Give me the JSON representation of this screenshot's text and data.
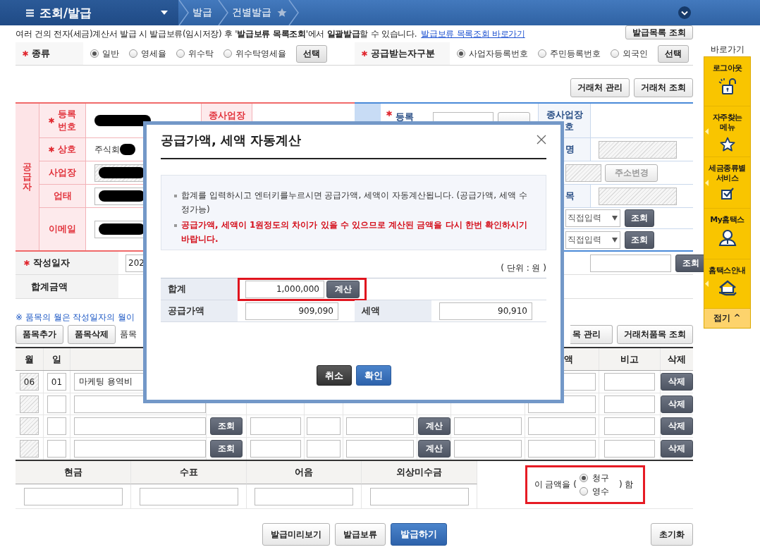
{
  "nav": {
    "title": "조회/발급",
    "breadcrumb": [
      {
        "label": "발급"
      },
      {
        "label": "건별발급",
        "favorite": false
      }
    ]
  },
  "notice": {
    "text": "여러 건의 전자(세금)계산서 발급 시 발급보류(임시저장) 후 '**발급보류 목록조회**'에서 **일괄발급**할 수 있습니다.",
    "link": "발급보류 목록조회 바로가기",
    "button": "발급목록 조회"
  },
  "type_row": {
    "groups": [
      {
        "label": "종류",
        "required": true,
        "options": [
          {
            "label": "일반",
            "selected": true
          },
          {
            "label": "영세율",
            "selected": false
          },
          {
            "label": "위수탁",
            "selected": false
          },
          {
            "label": "위수탁영세율",
            "selected": false
          }
        ],
        "button": "선택"
      },
      {
        "label": "공급받는자구분",
        "required": true,
        "options": [
          {
            "label": "사업자등록번호",
            "selected": true
          },
          {
            "label": "주민등록번호",
            "selected": false
          },
          {
            "label": "외국인",
            "selected": false
          }
        ],
        "button": "선택"
      }
    ]
  },
  "party_buttons": [
    "거래처 관리",
    "거래처 조회"
  ],
  "supplier": {
    "side_label": "공급자",
    "rows": [
      {
        "kind": "text",
        "label": "등록\n번호",
        "required": true,
        "redacted": true,
        "extra_label": "종사업장"
      },
      {
        "kind": "text",
        "label": "상호",
        "required": true,
        "value": "주식회",
        "redacted": true
      },
      {
        "kind": "input",
        "label": "사업장",
        "required": false,
        "redacted": true,
        "disabled": true
      },
      {
        "kind": "input",
        "label": "업태",
        "required": false,
        "redacted": true,
        "disabled": false
      },
      {
        "kind": "input",
        "label": "이메일",
        "required": false,
        "redacted": true,
        "disabled": false
      }
    ]
  },
  "buyer": {
    "id_label": "등록",
    "id_required": true,
    "branch_label": [
      "종사업장",
      "호"
    ],
    "rows": [
      {
        "kind": "labeled_field",
        "label": "명",
        "disabled": true
      },
      {
        "kind": "field_button",
        "disabled": true,
        "button": "주소변경"
      },
      {
        "kind": "labeled_field",
        "label": "목",
        "disabled": true
      },
      {
        "kind": "select_button",
        "value": "직접입력",
        "button": "조회",
        "disabled": false
      },
      {
        "kind": "select_button",
        "value": "직접입력",
        "button": "조회",
        "disabled": false
      }
    ]
  },
  "date_row": {
    "label": "작성일자",
    "required": true,
    "value": "202",
    "button": "조회"
  },
  "total_row": {
    "label": "합계금액"
  },
  "items": {
    "note": "※ 품목의 월은 작성일자의 월이",
    "buttons": [
      "품목추가",
      "품목삭제"
    ],
    "caption": "품목",
    "right_buttons": [
      "목 관리",
      "거래처품목 조회"
    ],
    "columns": [
      {
        "label": "월"
      },
      {
        "label": "일"
      },
      {
        "label": "액"
      },
      {
        "label": "비고"
      },
      {
        "label": "삭제"
      }
    ],
    "rows": [
      {
        "month": "06",
        "day": "01",
        "item": "마케팅 용역비",
        "month_disabled": true,
        "delete": "삭제"
      },
      {
        "month_disabled": true,
        "delete": "삭제"
      },
      {
        "month_disabled": true,
        "lookup": "조회",
        "calc": "계산",
        "delete": "삭제"
      },
      {
        "month_disabled": true,
        "lookup": "조회",
        "calc": "계산",
        "delete": "삭제"
      }
    ]
  },
  "payment": {
    "columns": [
      {
        "label": "현금"
      },
      {
        "label": "수표"
      },
      {
        "label": "어음"
      },
      {
        "label": "외상미수금"
      }
    ],
    "receipt": {
      "prefix": "이 금액을 (",
      "options": [
        {
          "label": "청구",
          "selected": true
        },
        {
          "label": "영수",
          "selected": false
        }
      ],
      "suffix": ") 함",
      "highlighted": true
    }
  },
  "actions": {
    "buttons": [
      {
        "label": "발급미리보기",
        "kind": "plain"
      },
      {
        "label": "발급보류",
        "kind": "plain"
      },
      {
        "label": "발급하기",
        "kind": "primary"
      },
      {
        "label": "초기화",
        "kind": "reset"
      }
    ]
  },
  "sidebar": {
    "title": "바로가기",
    "items": [
      {
        "label": "로그아웃",
        "submenu": false
      },
      {
        "label": "자주찾는\n메뉴",
        "submenu": true
      },
      {
        "label": "세금종류별\n서비스",
        "submenu": true
      },
      {
        "label": "My홈택스",
        "submenu": false
      },
      {
        "label": "홈택스안내",
        "submenu": true
      }
    ],
    "collapse": "접기 ^"
  },
  "modal": {
    "title": "공급가액, 세액 자동계산",
    "notes": [
      {
        "kind": "info",
        "text": "합계를 입력하시고 엔터키를누르시면 공급가액, 세액이 자동계산됩니다. (공급가액, 세액 수정가능)"
      },
      {
        "kind": "warning",
        "text": "공급가액, 세액이 1원정도의 차이가 있을 수 있으므로 계산된 금액을 다시 한번 확인하시기 바랍니다."
      }
    ],
    "unit": "( 단위 : 원 )",
    "total": {
      "label": "합계",
      "value": "1,000,000",
      "button": "계산",
      "highlighted": true
    },
    "supply": {
      "label": "공급가액",
      "value": "909,090"
    },
    "tax": {
      "label": "세액",
      "value": "90,910"
    },
    "buttons": [
      {
        "label": "취소",
        "kind": "secondary"
      },
      {
        "label": "확인",
        "kind": "primary"
      }
    ]
  }
}
